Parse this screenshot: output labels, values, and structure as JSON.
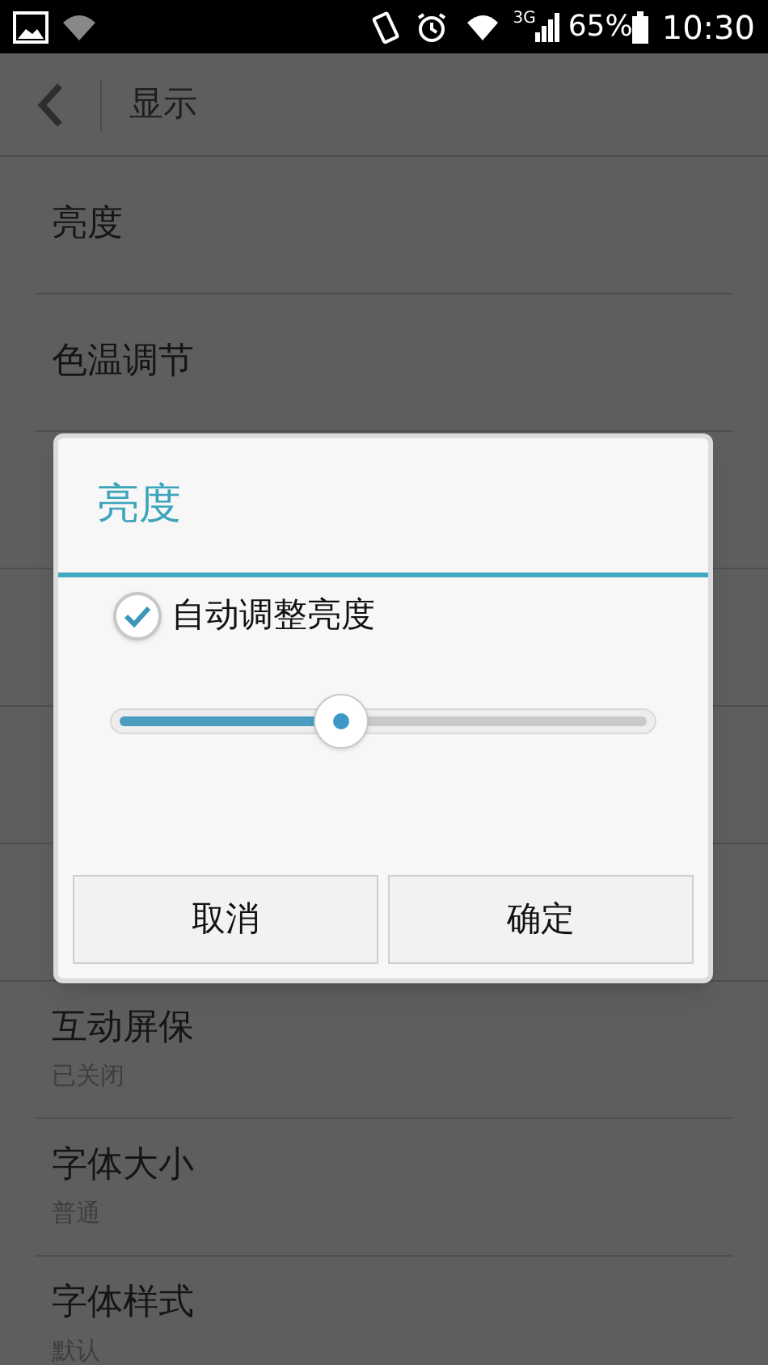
{
  "status_bar": {
    "network": "3G",
    "battery": "65%",
    "time": "10:30"
  },
  "header": {
    "title": "显示"
  },
  "settings": [
    {
      "title": "亮度"
    },
    {
      "title": "色温调节"
    },
    {
      "kind": "hidden"
    },
    {
      "kind": "hidden"
    },
    {
      "kind": "hidden"
    },
    {
      "kind": "hidden"
    },
    {
      "title": "互动屏保",
      "subtitle": "已关闭"
    },
    {
      "title": "字体大小",
      "subtitle": "普通"
    },
    {
      "title": "字体样式",
      "subtitle": "默认"
    }
  ],
  "dialog": {
    "title": "亮度",
    "auto": {
      "label": "自动调整亮度",
      "checked": true
    },
    "slider": {
      "level": 0.42
    },
    "buttons": [
      "取消",
      "确定"
    ]
  }
}
